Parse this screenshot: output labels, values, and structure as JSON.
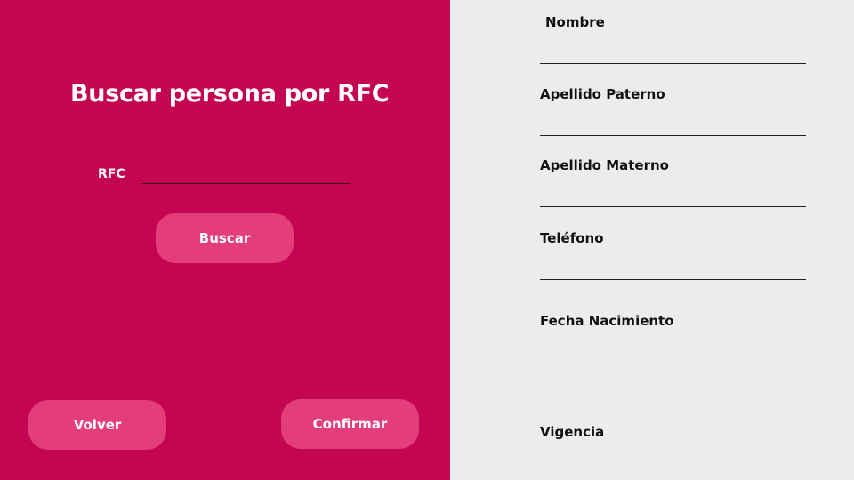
{
  "search": {
    "title": "Buscar persona por RFC",
    "rfc_label": "RFC",
    "rfc_value": "",
    "search_button": "Buscar"
  },
  "actions": {
    "back_button": "Volver",
    "confirm_button": "Confirmar"
  },
  "details": {
    "fields": [
      {
        "label": "Nombre",
        "value": ""
      },
      {
        "label": "Apellido Paterno",
        "value": ""
      },
      {
        "label": "Apellido Materno",
        "value": ""
      },
      {
        "label": "Teléfono",
        "value": ""
      },
      {
        "label": "Fecha Nacimiento",
        "value": ""
      },
      {
        "label": "Vigencia",
        "value": ""
      }
    ]
  },
  "colors": {
    "left_panel_bg": "#c40652",
    "button_bg": "#e33d7a",
    "right_panel_bg": "#ececec"
  }
}
